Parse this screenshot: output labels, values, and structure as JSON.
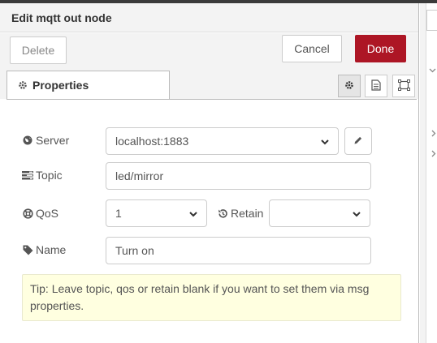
{
  "tray": {
    "title": "Edit mqtt out node",
    "delete_label": "Delete",
    "cancel_label": "Cancel",
    "done_label": "Done",
    "accent_color": "#ad1625"
  },
  "tabs": {
    "properties_label": "Properties",
    "icons": [
      "gear-icon",
      "description-icon",
      "appearance-icon"
    ]
  },
  "form": {
    "server": {
      "label": "Server",
      "value": "localhost:1883",
      "icon": "globe-icon"
    },
    "topic": {
      "label": "Topic",
      "value": "led/mirror",
      "icon": "tasks-icon"
    },
    "qos": {
      "label": "QoS",
      "value": "1",
      "icon": "life-ring-icon"
    },
    "retain": {
      "label": "Retain",
      "value": "",
      "icon": "history-icon"
    },
    "name": {
      "label": "Name",
      "value": "Turn on",
      "icon": "tag-icon"
    }
  },
  "tip": {
    "text": "Tip: Leave topic, qos or retain blank if you want to set them via msg properties."
  }
}
